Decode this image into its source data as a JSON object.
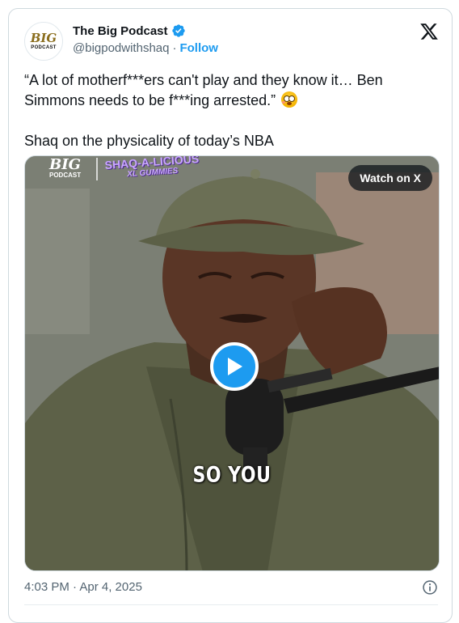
{
  "author": {
    "display_name": "The Big Podcast",
    "handle": "@bigpodwithshaq",
    "separator": "·",
    "follow_label": "Follow",
    "avatar_text_top": "BIG",
    "avatar_text_bottom": "PODCAST",
    "verified_icon": "verified-badge-icon"
  },
  "tweet": {
    "text_line1": "“A lot of motherf***ers can't play and they know it… Ben Simmons needs to be f***ing arrested.”",
    "emoji": "flushed-face-emoji",
    "text_line2": "Shaq on the physicality of today’s NBA"
  },
  "media": {
    "watch_label": "Watch on X",
    "caption": "SO YOU",
    "overlay_logo_top": "BIG",
    "overlay_logo_bottom": "PODCAST",
    "overlay_brand": "SHAQ-A-LICIOUS",
    "overlay_brand_sub": "XL GUMMIES",
    "play_icon": "play-icon"
  },
  "footer": {
    "timestamp": "4:03 PM · Apr 4, 2025",
    "info_icon": "info-icon"
  },
  "colors": {
    "accent": "#1d9bf0",
    "text": "#0f1419",
    "muted": "#536471",
    "border": "#cfd9de"
  }
}
